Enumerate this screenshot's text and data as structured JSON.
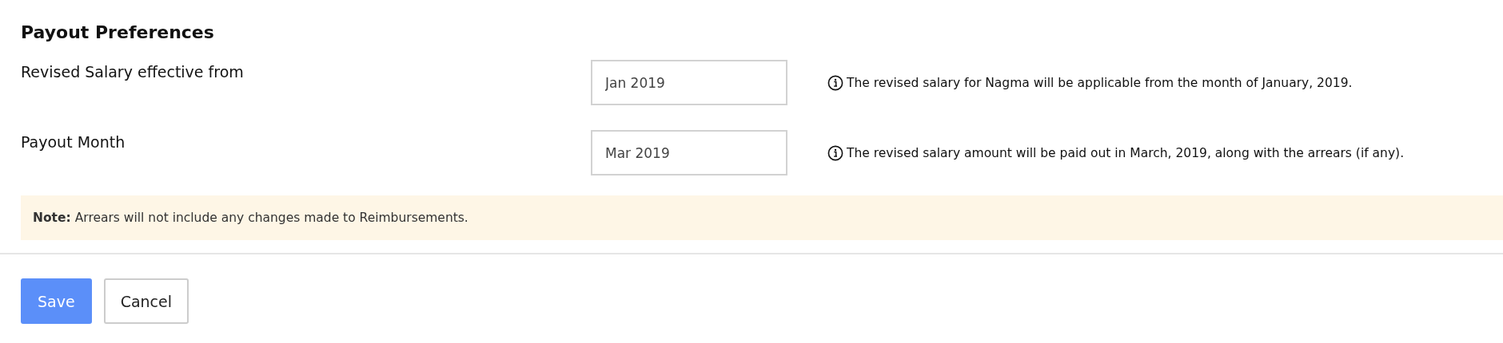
{
  "title": "Payout Preferences",
  "fields": [
    {
      "label": "Revised Salary effective from",
      "value": "Jan 2019",
      "hint": "The revised salary for Nagma will be applicable from the month of January, 2019."
    },
    {
      "label": "Payout Month",
      "value": "Mar 2019",
      "hint": "The revised salary amount will be paid out in March, 2019, along with the arrears (if any)."
    }
  ],
  "note": "**Note:** Arrears will not include any changes made to Reimbursements.",
  "buttons": [
    {
      "label": "Save",
      "kind": "primary"
    },
    {
      "label": "Cancel",
      "kind": "secondary"
    }
  ]
}
